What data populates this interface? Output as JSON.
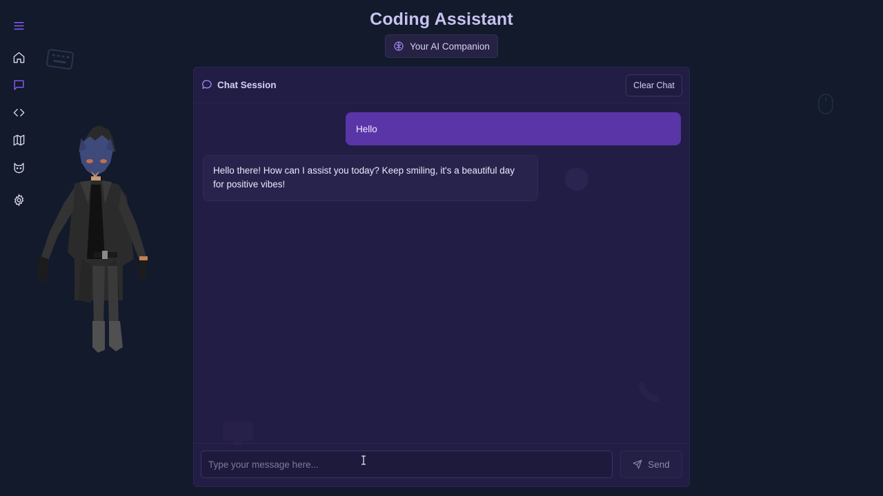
{
  "header": {
    "title": "Coding Assistant",
    "subtitle": "Your AI Companion"
  },
  "sidebar": {
    "items": [
      {
        "icon": "menu-icon"
      },
      {
        "icon": "home-icon"
      },
      {
        "icon": "chat-icon",
        "active": true
      },
      {
        "icon": "code-icon"
      },
      {
        "icon": "map-icon"
      },
      {
        "icon": "cat-icon"
      },
      {
        "icon": "settings-icon"
      }
    ]
  },
  "chat": {
    "session_label": "Chat Session",
    "clear_label": "Clear Chat",
    "messages": [
      {
        "role": "user",
        "text": "Hello"
      },
      {
        "role": "assistant",
        "text": "Hello there! How can I assist you today? Keep smiling, it's a beautiful day for positive vibes!"
      }
    ],
    "input_placeholder": "Type your message here...",
    "input_value": "",
    "send_label": "Send"
  },
  "colors": {
    "background": "#121a2b",
    "panel": "#211d44",
    "accent": "#8b5cf6",
    "user_bubble": "#5a35a8",
    "title": "#c9c2f0"
  }
}
